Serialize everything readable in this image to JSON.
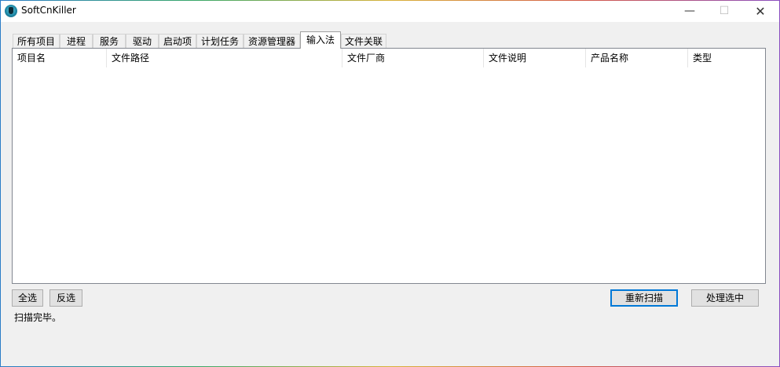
{
  "window": {
    "title": "SoftCnKiller",
    "icon": "app-logo-icon",
    "controls": {
      "minimize": "—",
      "maximize": "☐",
      "close": "✕"
    }
  },
  "tabs": [
    {
      "label": "所有项目",
      "active": false
    },
    {
      "label": "进程",
      "active": false
    },
    {
      "label": "服务",
      "active": false
    },
    {
      "label": "驱动",
      "active": false
    },
    {
      "label": "启动项",
      "active": false
    },
    {
      "label": "计划任务",
      "active": false
    },
    {
      "label": "资源管理器",
      "active": false
    },
    {
      "label": "输入法",
      "active": true
    },
    {
      "label": "文件关联",
      "active": false
    }
  ],
  "table": {
    "columns": [
      "项目名",
      "文件路径",
      "文件厂商",
      "文件说明",
      "产品名称",
      "类型"
    ],
    "rows": []
  },
  "buttons": {
    "select_all": "全选",
    "invert_selection": "反选",
    "rescan": "重新扫描",
    "process_selected": "处理选中"
  },
  "status": "扫描完毕。",
  "colors": {
    "accent": "#0078d7",
    "window_bg": "#f0f0f0"
  }
}
